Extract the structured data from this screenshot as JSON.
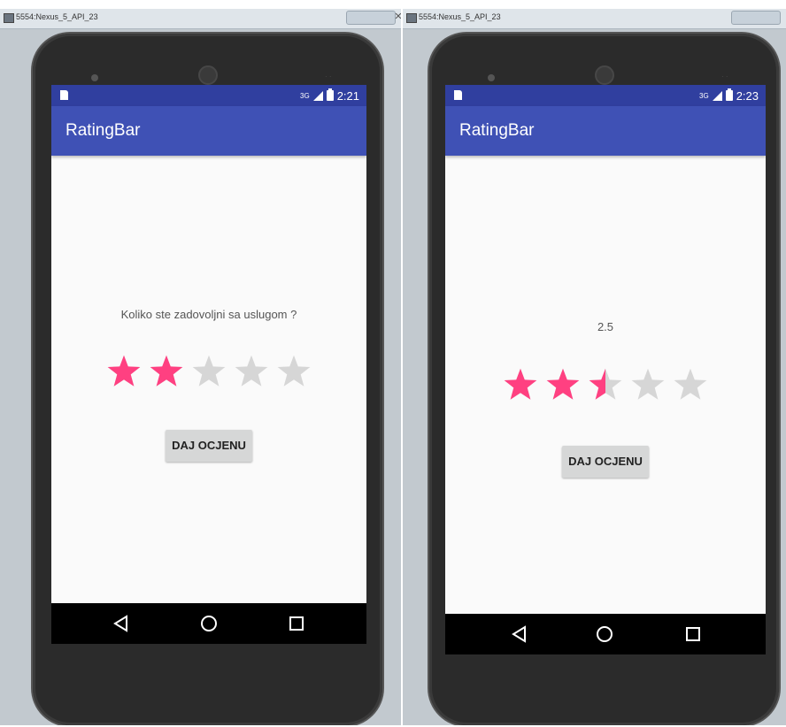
{
  "left": {
    "window_title": "5554:Nexus_5_API_23",
    "status_time": "2:21",
    "network": "3G",
    "app_title": "RatingBar",
    "prompt_text": "Koliko ste zadovoljni sa uslugom ?",
    "rating": 2,
    "rating_max": 5,
    "button_label": "DAJ OCJENU"
  },
  "right": {
    "window_title": "5554:Nexus_5_API_23",
    "status_time": "2:23",
    "network": "3G",
    "app_title": "RatingBar",
    "prompt_text": "2.5",
    "rating": 2.5,
    "rating_max": 5,
    "button_label": "DAJ OCJENU"
  },
  "colors": {
    "status_bar": "#303f9f",
    "app_bar": "#3f51b5",
    "star_filled": "#ff4081",
    "star_empty": "#d6d6d6",
    "screen_bg": "#fafafa"
  },
  "icons": {
    "back": "back-triangle-icon",
    "home": "home-circle-icon",
    "recents": "recents-square-icon"
  }
}
